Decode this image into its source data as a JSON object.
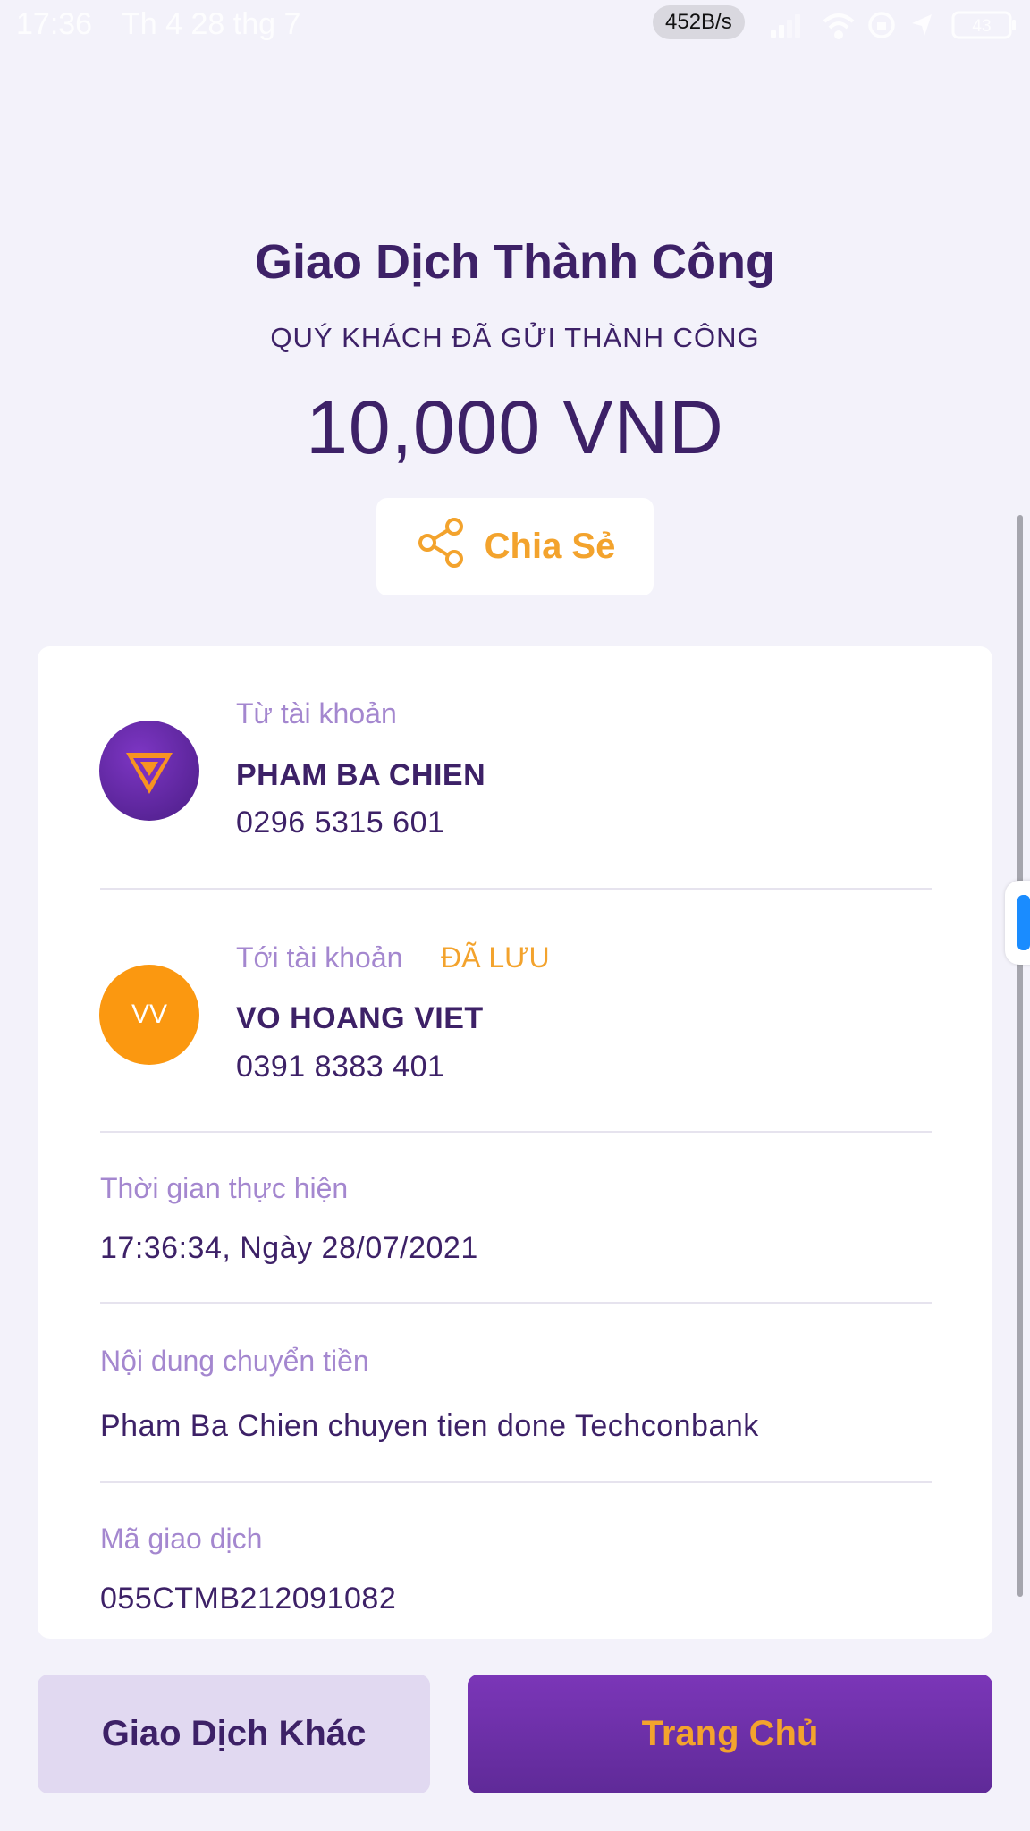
{
  "status_bar": {
    "time": "17:36",
    "date": "Th 4 28 thg 7",
    "network_speed": "452B/s",
    "battery": "43",
    "icons": [
      "signal-icon",
      "wifi-icon",
      "orientation-lock-icon",
      "location-icon",
      "battery-icon"
    ]
  },
  "header": {
    "title": "Giao Dịch Thành Công",
    "subtitle": "QUÝ KHÁCH ĐÃ GỬI THÀNH CÔNG",
    "amount": "10,000 VND"
  },
  "share_button": {
    "label": "Chia Sẻ",
    "icon": "share-icon"
  },
  "from_account": {
    "label": "Từ tài khoản",
    "name": "PHAM BA CHIEN",
    "number": "0296 5315 601"
  },
  "to_account": {
    "label": "Tới tài khoản",
    "saved_tag": "ĐÃ LƯU",
    "avatar_initials": "VV",
    "name": "VO HOANG VIET",
    "number": "0391 8383 401"
  },
  "details": {
    "time_label": "Thời gian thực hiện",
    "time_value": "17:36:34, Ngày 28/07/2021",
    "content_label": "Nội dung chuyển tiền",
    "content_value": "Pham Ba Chien chuyen tien done Techconbank",
    "code_label": "Mã giao dịch",
    "code_value": "055CTMB212091082"
  },
  "footer": {
    "other_transaction_label": "Giao Dịch Khác",
    "home_label": "Trang Chủ"
  },
  "colors": {
    "primary_purple": "#3d2167",
    "accent_orange": "#f3a32d",
    "label_lavender": "#a487cf",
    "background": "#f3f2fa"
  }
}
